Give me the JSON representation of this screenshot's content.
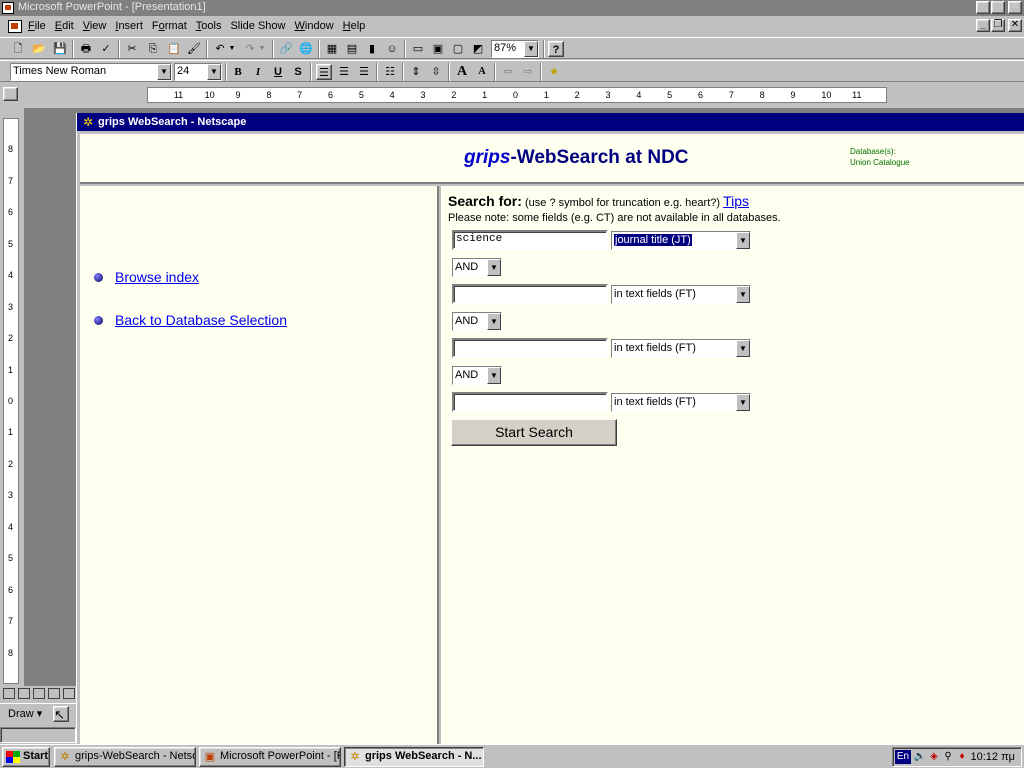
{
  "app": {
    "title": "Microsoft PowerPoint - [Presentation1]",
    "menu": [
      "File",
      "Edit",
      "View",
      "Insert",
      "Format",
      "Tools",
      "Slide Show",
      "Window",
      "Help"
    ],
    "menu_underline": [
      "F",
      "E",
      "V",
      "I",
      "o",
      "T",
      "D",
      "W",
      "H"
    ]
  },
  "toolbar": {
    "zoom": "87%",
    "font": "Times New Roman",
    "font_size": "24"
  },
  "ruler": {
    "h_ticks": [
      "11",
      "10",
      "9",
      "8",
      "7",
      "6",
      "5",
      "4",
      "3",
      "2",
      "1",
      "0",
      "1",
      "2",
      "3",
      "4",
      "5",
      "6",
      "7",
      "8",
      "9",
      "10",
      "11"
    ],
    "v_ticks": [
      "8",
      "7",
      "6",
      "5",
      "4",
      "3",
      "2",
      "1",
      "0",
      "1",
      "2",
      "3",
      "4",
      "5",
      "6",
      "7",
      "8"
    ]
  },
  "netscape": {
    "title": "grips WebSearch - Netscape",
    "heading_prefix": "grips",
    "heading_rest": "-WebSearch at NDC",
    "db_label": "Database(s):",
    "db_value": "Union Catalogue",
    "links": [
      "Browse index",
      "Back to Database Selection"
    ],
    "search_label": "Search for:",
    "search_hint": "(use ? symbol for truncation e.g. heart?)",
    "tips": "Tips",
    "note": "Please note: some fields (e.g. CT) are not available in all databases.",
    "rows": [
      {
        "value": "science",
        "field": "journal title (JT)"
      },
      {
        "value": "",
        "field": "in text fields (FT)"
      },
      {
        "value": "",
        "field": "in text fields (FT)"
      },
      {
        "value": "",
        "field": "in text fields (FT)"
      }
    ],
    "operators": [
      "AND",
      "AND",
      "AND"
    ],
    "submit": "Start Search"
  },
  "drawbar": {
    "draw": "Draw"
  },
  "taskbar": {
    "start": "Start",
    "tasks": [
      "grips-WebSearch - Netsca...",
      "Microsoft PowerPoint - [Pr...",
      "grips WebSearch - N..."
    ],
    "lang": "En",
    "clock": "10:12 πμ"
  }
}
